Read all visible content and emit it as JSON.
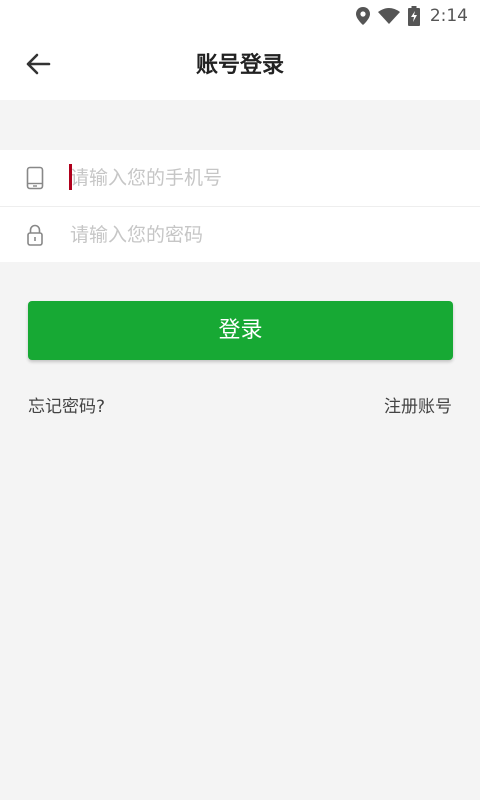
{
  "status_bar": {
    "time": "2:14",
    "icons": [
      "location-icon",
      "wifi-icon",
      "battery-charging-icon"
    ]
  },
  "header": {
    "title": "账号登录",
    "back_icon": "arrow-left-icon"
  },
  "form": {
    "phone": {
      "placeholder": "请输入您的手机号",
      "value": "",
      "icon": "phone-icon"
    },
    "password": {
      "placeholder": "请输入您的密码",
      "value": "",
      "icon": "lock-icon"
    }
  },
  "actions": {
    "login_label": "登录",
    "forgot_label": "忘记密码?",
    "register_label": "注册账号"
  },
  "colors": {
    "primary": "#17a934",
    "background": "#f4f4f4",
    "caret": "#b0001c"
  }
}
